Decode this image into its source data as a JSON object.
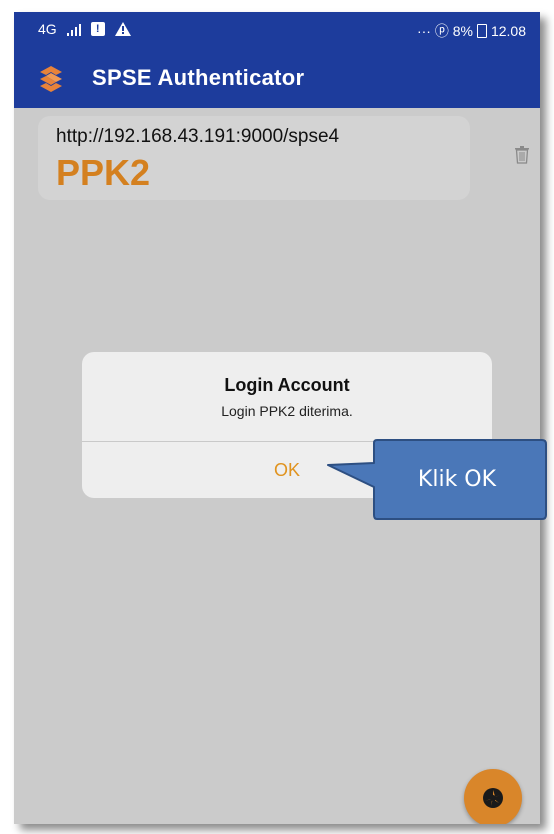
{
  "status_bar": {
    "network": "4G",
    "right_text": "··· ⓟ 8%",
    "time": "12.08"
  },
  "app_bar": {
    "title": "SPSE Authenticator",
    "logo_icon": "spse-logo-icon",
    "color": "#1d3c9c"
  },
  "account": {
    "url": "http://192.168.43.191:9000/spse4",
    "name": "PPK2",
    "name_color": "#d4801f",
    "delete_icon": "trash-icon"
  },
  "dialog": {
    "title": "Login Account",
    "message": "Login PPK2 diterima.",
    "ok_label": "OK",
    "ok_color": "#e0931f"
  },
  "callout": {
    "text": "Klik OK",
    "color": "#4a77b8"
  },
  "fab": {
    "icon": "camera-shutter-icon",
    "color": "#d9862a"
  }
}
